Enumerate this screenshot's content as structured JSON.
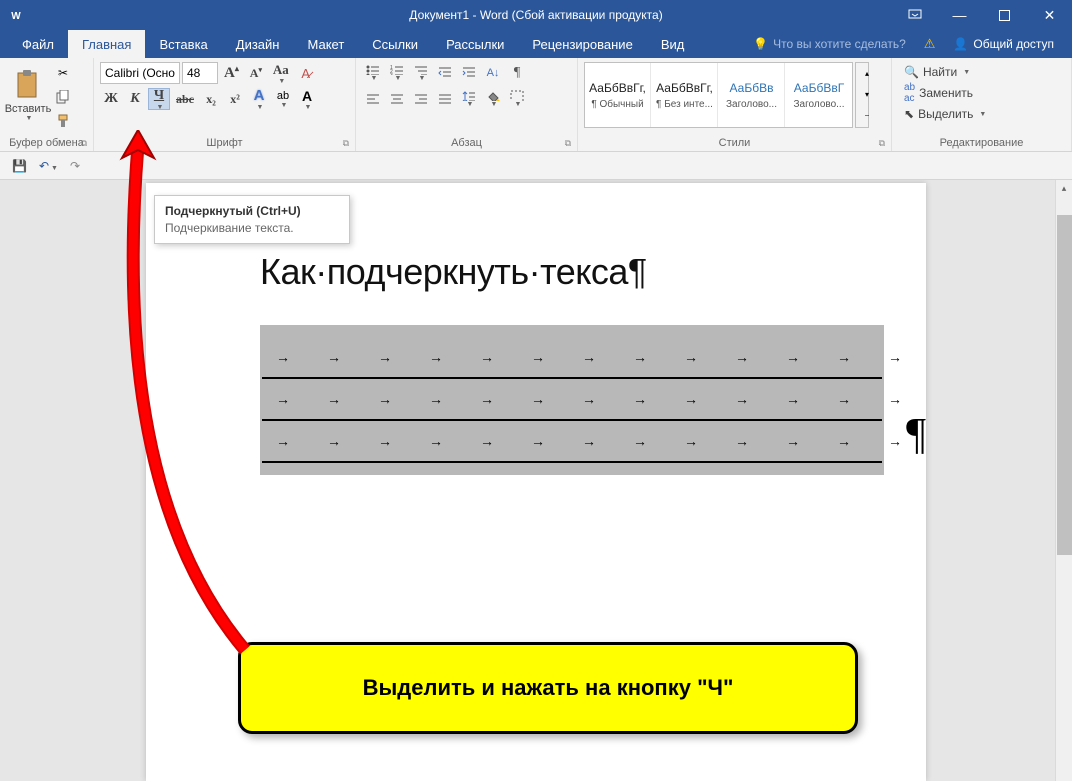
{
  "titlebar": {
    "title": "Документ1 - Word (Сбой активации продукта)"
  },
  "tabs": {
    "items": [
      "Файл",
      "Главная",
      "Вставка",
      "Дизайн",
      "Макет",
      "Ссылки",
      "Рассылки",
      "Рецензирование",
      "Вид"
    ],
    "tell_me": "Что вы хотите сделать?",
    "share": "Общий доступ"
  },
  "ribbon": {
    "clipboard": {
      "paste": "Вставить",
      "label": "Буфер обмена"
    },
    "font": {
      "name": "Calibri (Осно",
      "size": "48",
      "bold": "Ж",
      "italic": "К",
      "underline": "Ч",
      "label": "Шрифт"
    },
    "paragraph": {
      "label": "Абзац"
    },
    "styles": {
      "label": "Стили",
      "items": [
        {
          "preview": "АаБбВвГг,",
          "name": "¶ Обычный",
          "blue": false
        },
        {
          "preview": "АаБбВвГг,",
          "name": "¶ Без инте...",
          "blue": false
        },
        {
          "preview": "АаБбВв",
          "name": "Заголово...",
          "blue": true
        },
        {
          "preview": "АаБбВвГ",
          "name": "Заголово...",
          "blue": true
        }
      ]
    },
    "editing": {
      "find": "Найти",
      "replace": "Заменить",
      "select": "Выделить",
      "label": "Редактирование"
    }
  },
  "tooltip": {
    "title": "Подчеркнутый (Ctrl+U)",
    "desc": "Подчеркивание текста."
  },
  "document": {
    "heading": "Как·подчеркнуть·текса¶"
  },
  "callout": {
    "text": "Выделить и нажать на кнопку \"Ч\""
  }
}
